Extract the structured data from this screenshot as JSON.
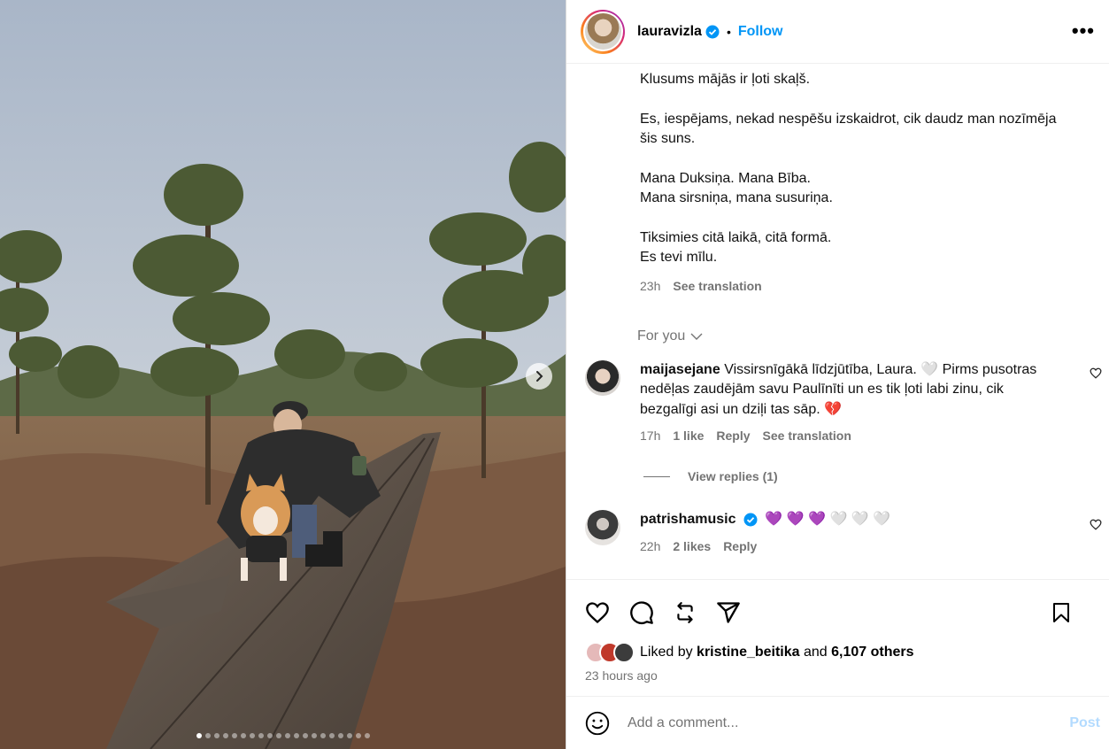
{
  "post": {
    "username": "lauravizla",
    "bullet": "•",
    "follow_label": "Follow",
    "more_label": "•••",
    "caption_paragraphs": [
      "Klusums mājās ir ļoti skaļš.",
      "Es, iespējams, nekad nespēšu izskaidrot, cik daudz man nozīmēja\nšis suns.",
      "Mana Duksiņa. Mana Bība.\nMana sirsniņa, mana susuriņa.",
      "Tiksimies citā laikā, citā formā.\nEs tevi mīlu."
    ],
    "caption_time": "23h",
    "see_translation": "See translation",
    "for_you": "For you"
  },
  "comments": [
    {
      "username": "maijasejane",
      "text": "Vissirsnīgākā līdzjūtība, Laura. 🤍  Pirms pusotras nedēļas zaudējām savu Paulīnīti un es tik ļoti labi zinu, cik bezgalīgi asi un dziļi tas sāp. 💔",
      "time": "17h",
      "likes": "1 like",
      "reply": "Reply",
      "see_translation": "See translation",
      "view_replies": "View replies (1)"
    },
    {
      "username": "patrishamusic",
      "text": "💜 💜 💜 🤍 🤍 🤍",
      "time": "22h",
      "likes": "2 likes",
      "reply": "Reply"
    }
  ],
  "footer": {
    "liked_by_prefix": "Liked by",
    "liked_by_user": "kristine_beitika",
    "liked_by_and": "and",
    "liked_by_others": "6,107 others",
    "time_ago": "23 hours ago",
    "comment_placeholder": "Add a comment...",
    "post_label": "Post"
  },
  "carousel": {
    "total_slides": 20,
    "active_index": 0
  },
  "colors": {
    "link": "#0095f6",
    "muted": "#737373",
    "post_disabled": "#b3dbff",
    "verified": "#0095f6"
  },
  "icons": [
    "heart-icon",
    "comment-icon",
    "repost-icon",
    "share-icon",
    "bookmark-icon",
    "emoji-icon",
    "chevron-right-icon",
    "chevron-down-icon",
    "verified-icon",
    "more-icon"
  ]
}
